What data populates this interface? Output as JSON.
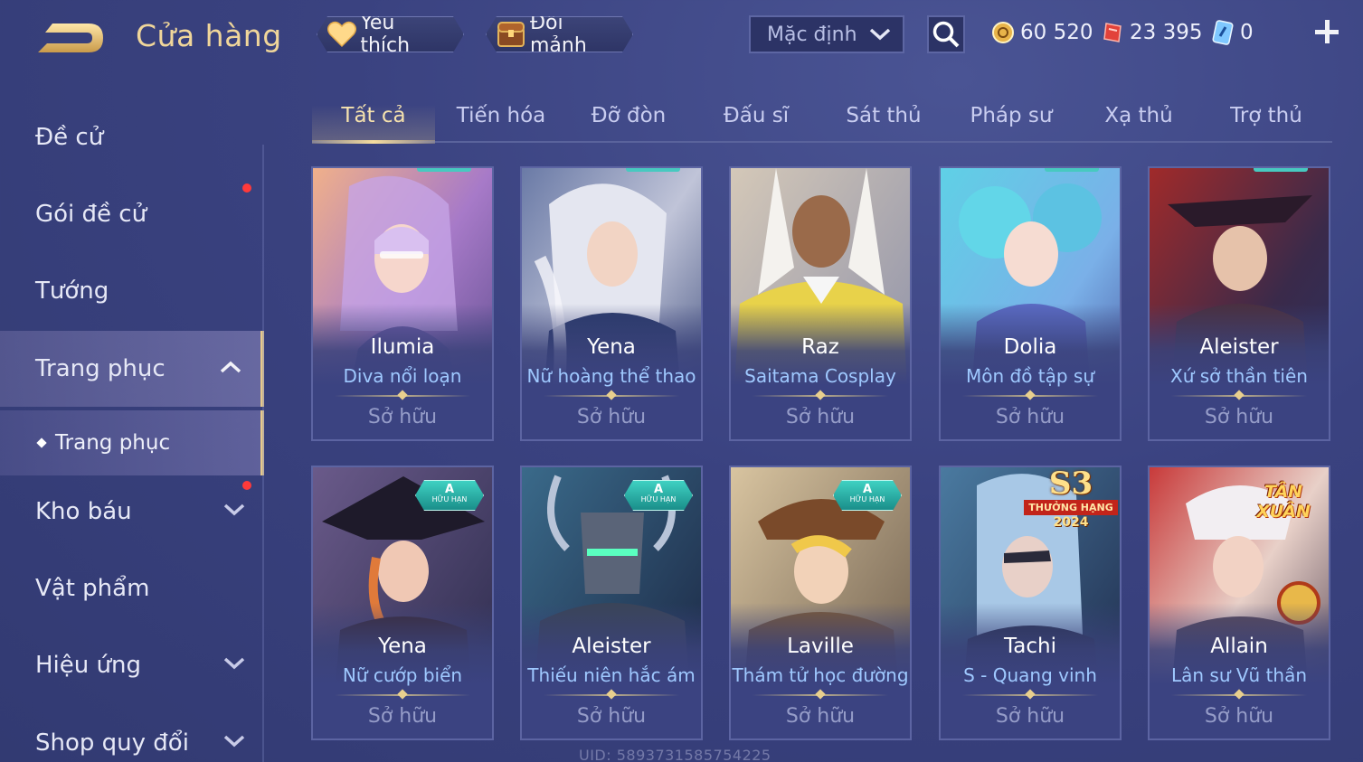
{
  "header": {
    "title": "Cửa hàng",
    "favorite_label": "Yêu thích",
    "exchange_label": "Đổi mảnh",
    "sort_value": "Mặc định",
    "currencies": [
      {
        "name": "gold",
        "value": "60 520"
      },
      {
        "name": "voucher",
        "value": "23 395"
      },
      {
        "name": "gem",
        "value": "0"
      }
    ]
  },
  "sidebar": {
    "items": [
      {
        "label": "Đề cử"
      },
      {
        "label": "Gói đề cử"
      },
      {
        "label": "Tướng"
      },
      {
        "label": "Trang phục"
      },
      {
        "label": "Trang phục"
      },
      {
        "label": "Kho báu"
      },
      {
        "label": "Vật phẩm"
      },
      {
        "label": "Hiệu ứng"
      },
      {
        "label": "Shop quy đổi"
      }
    ]
  },
  "tabs": [
    {
      "label": "Tất cả"
    },
    {
      "label": "Tiến hóa"
    },
    {
      "label": "Đỡ đòn"
    },
    {
      "label": "Đấu sĩ"
    },
    {
      "label": "Sát thủ"
    },
    {
      "label": "Pháp sư"
    },
    {
      "label": "Xạ thủ"
    },
    {
      "label": "Trợ thủ"
    }
  ],
  "cards": [
    {
      "hero": "Ilumia",
      "skin": "Diva nổi loạn",
      "status": "Sở hữu"
    },
    {
      "hero": "Yena",
      "skin": "Nữ hoàng thể thao",
      "status": "Sở hữu"
    },
    {
      "hero": "Raz",
      "skin": "Saitama Cosplay",
      "status": "Sở hữu"
    },
    {
      "hero": "Dolia",
      "skin": "Môn đồ tập sự",
      "status": "Sở hữu"
    },
    {
      "hero": "Aleister",
      "skin": "Xứ sở thần tiên",
      "status": "Sở hữu"
    },
    {
      "hero": "Yena",
      "skin": "Nữ cướp biển",
      "status": "Sở hữu",
      "badge_top": "A",
      "badge_bottom": "HỮU HẠN"
    },
    {
      "hero": "Aleister",
      "skin": "Thiếu niên hắc ám",
      "status": "Sở hữu",
      "badge_top": "A",
      "badge_bottom": "HỮU HẠN"
    },
    {
      "hero": "Laville",
      "skin": "Thám tử học đường",
      "status": "Sở hữu",
      "badge_top": "A",
      "badge_bottom": "HỮU HẠN"
    },
    {
      "hero": "Tachi",
      "skin": "S - Quang vinh",
      "status": "Sở hữu",
      "badge_big": "S3",
      "badge_band": "THƯỞNG HẠNG",
      "badge_year": "2024"
    },
    {
      "hero": "Allain",
      "skin": "Lân sư Vũ thần",
      "status": "Sở hữu",
      "badge_event": "TÂN XUÂN"
    }
  ],
  "watermark": "UID: 5893731585754225",
  "colors": {
    "background": "#3a4280",
    "gold_accent": "#f0d69a",
    "skin_name": "#9fc9ff",
    "notification_dot": "#ff3a3a"
  }
}
